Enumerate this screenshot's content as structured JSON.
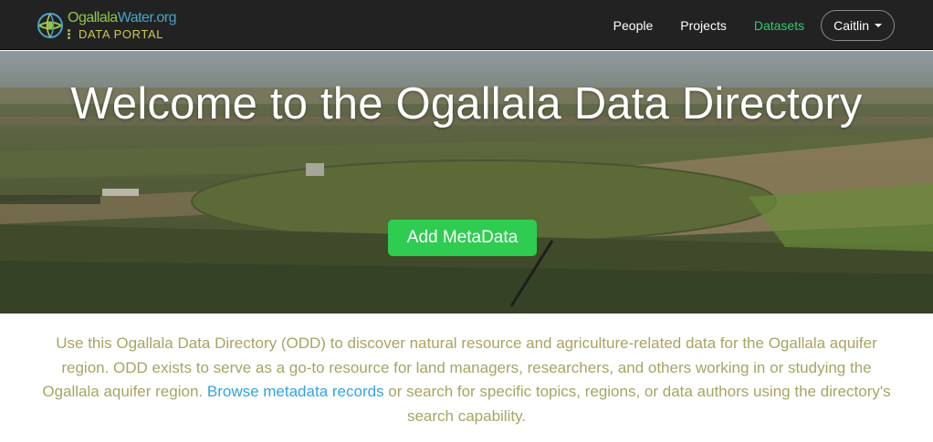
{
  "brand": {
    "name_part1": "Ogallala",
    "name_part2": "Water.org",
    "subtitle": "DATA PORTAL",
    "icon": "globe-logo-icon"
  },
  "nav": {
    "items": [
      {
        "label": "People",
        "active": false
      },
      {
        "label": "Projects",
        "active": false
      },
      {
        "label": "Datasets",
        "active": true
      }
    ],
    "user": "Caitlin",
    "user_icon": "caret-down-icon"
  },
  "hero": {
    "title": "Welcome to the Ogallala Data Directory",
    "button_label": "Add MetaData"
  },
  "intro": {
    "text_before": "Use this Ogallala Data Directory (ODD) to discover natural resource and agriculture-related data for the Ogallala aquifer region. ODD exists to serve as a go-to resource for land managers, researchers, and others working in or studying the Ogallala aquifer region. ",
    "link_text": "Browse metadata records",
    "text_after": " or search for specific topics, regions, or data authors using the directory's search capability."
  },
  "colors": {
    "navbar_bg": "#222222",
    "active_nav": "#2ecc71",
    "button_green": "#2ecc51",
    "intro_text": "#a6a563",
    "link": "#2fa4e7"
  }
}
